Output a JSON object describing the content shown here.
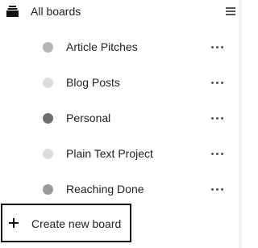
{
  "header": {
    "label": "All boards",
    "icon": "boards-stack-icon",
    "menu_icon": "hamburger-menu-icon"
  },
  "boards": [
    {
      "label": "Article Pitches",
      "color": "#b5b5b5",
      "dot_style": "solid-light",
      "more_icon": "more-horizontal-icon"
    },
    {
      "label": "Blog Posts",
      "color": "#e2e2e2",
      "dot_style": "dotted",
      "more_icon": "more-horizontal-icon"
    },
    {
      "label": "Personal",
      "color": "#6e6e6e",
      "dot_style": "solid-dark",
      "more_icon": "more-horizontal-icon"
    },
    {
      "label": "Plain Text Project",
      "color": "#e6e6e6",
      "dot_style": "dotted",
      "more_icon": "more-horizontal-icon"
    },
    {
      "label": "Reaching Done",
      "color": "#9a9a9a",
      "dot_style": "solid-medium",
      "more_icon": "more-horizontal-icon"
    }
  ],
  "create": {
    "label": "Create new board",
    "icon": "plus-icon"
  }
}
